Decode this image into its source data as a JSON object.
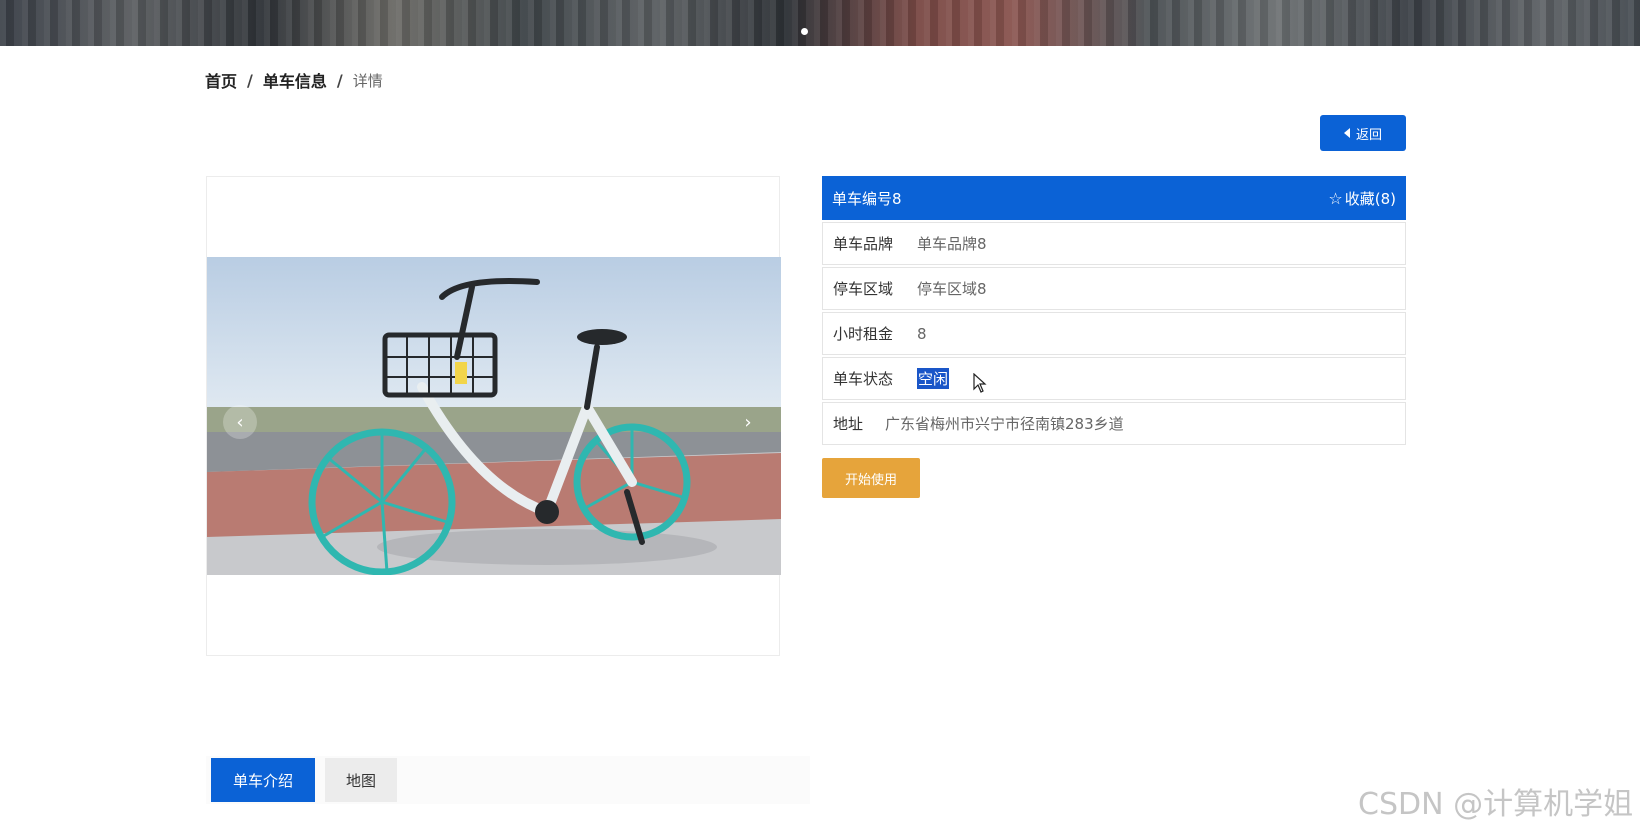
{
  "breadcrumb": {
    "home": "首页",
    "list": "单车信息",
    "current": "详情",
    "separator": "/"
  },
  "back_button": {
    "label": "返回",
    "icon": "caret-left-icon"
  },
  "detail": {
    "title": "单车编号8",
    "favorite_label": "收藏(8)",
    "favorite_icon": "star-outline-icon",
    "fields": [
      {
        "key": "单车品牌",
        "value": "单车品牌8"
      },
      {
        "key": "停车区域",
        "value": "停车区域8"
      },
      {
        "key": "小时租金",
        "value": "8"
      },
      {
        "key": "单车状态",
        "value": "空闲"
      },
      {
        "key": "地址",
        "value": "广东省梅州市兴宁市径南镇283乡道"
      }
    ],
    "start_button": "开始使用"
  },
  "carousel": {
    "prev": "‹",
    "next": "›"
  },
  "tabs": [
    {
      "label": "单车介绍",
      "active": true
    },
    {
      "label": "地图",
      "active": false
    }
  ],
  "watermark": "CSDN @计算机学姐",
  "colors": {
    "primary": "#0b62d6",
    "accent": "#e6a43b",
    "selection": "#1a56c8"
  }
}
